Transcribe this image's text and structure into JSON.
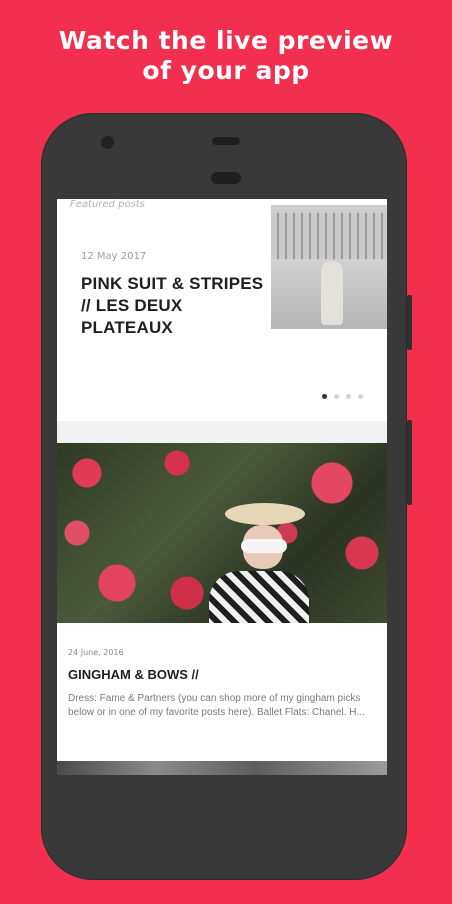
{
  "banner": {
    "line1": "Watch the live preview",
    "line2": "of your app"
  },
  "app": {
    "featured_label": "Featured posts",
    "featured": {
      "date": "12 May 2017",
      "title": "PINK SUIT & STRIPES // LES DEUX PLATEAUX",
      "slides_count": 4,
      "active_slide": 1
    },
    "post": {
      "date": "24 June, 2016",
      "title": "GINGHAM & BOWS //",
      "excerpt": "Dress: Fame & Partners (you can shop more of my gingham picks below or in one of my favorite posts here). Ballet Flats: Chanel. H..."
    }
  },
  "colors": {
    "background": "#f22f4e",
    "phone_body": "#393939"
  }
}
